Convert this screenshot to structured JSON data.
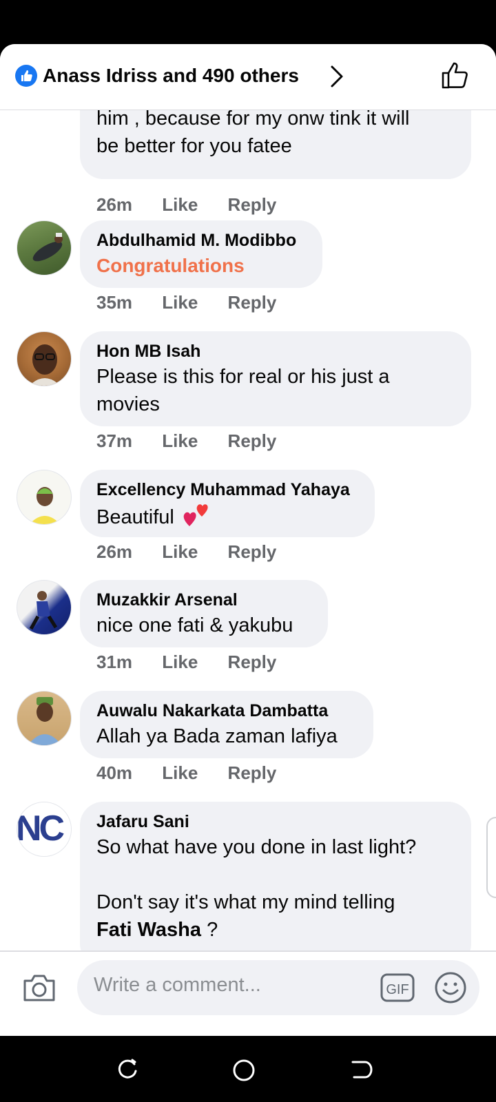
{
  "header": {
    "reactors": "Anass Idriss and 490 others",
    "icons": {
      "badge": "like-badge-icon",
      "chevron": "chevron-right-icon",
      "like": "thumbs-up-icon"
    },
    "accent": "#1877f2"
  },
  "comments": [
    {
      "author": "",
      "lines": [
        "him , because for my onw tink it will",
        "be better for you fatee"
      ],
      "time": "26m",
      "like": "Like",
      "reply": "Reply"
    },
    {
      "author": "Abdulhamid M. Modibbo",
      "lines": [
        "Congratulations"
      ],
      "highlight_color": "#f0714a",
      "time": "35m",
      "like": "Like",
      "reply": "Reply"
    },
    {
      "author": "Hon MB Isah",
      "lines": [
        "Please is this for real or his just a",
        "movies"
      ],
      "time": "37m",
      "like": "Like",
      "reply": "Reply"
    },
    {
      "author": "Excellency Muhammad Yahaya",
      "lines": [
        "Beautiful"
      ],
      "emoji": "two-hearts-icon",
      "time": "26m",
      "like": "Like",
      "reply": "Reply"
    },
    {
      "author": "Muzakkir Arsenal",
      "lines": [
        "nice one fati & yakubu"
      ],
      "time": "31m",
      "like": "Like",
      "reply": "Reply"
    },
    {
      "author": "Auwalu Nakarkata Dambatta",
      "lines": [
        "Allah ya Bada zaman lafiya"
      ],
      "time": "40m",
      "like": "Like",
      "reply": "Reply"
    },
    {
      "author": "Jafaru Sani",
      "lines": [
        "So what have you done in last light?",
        "",
        "Don't say it's what my mind telling"
      ],
      "mention": "Fati Washa",
      "mention_suffix": " ?",
      "avatar_text": "NC"
    }
  ],
  "composer": {
    "placeholder": "Write a comment...",
    "gif_label": "GIF",
    "icons": {
      "camera": "camera-icon",
      "gif": "gif-icon",
      "emoji": "emoji-icon"
    }
  },
  "navbar": {
    "icons": [
      "recent-apps-icon",
      "home-icon",
      "back-icon"
    ]
  }
}
